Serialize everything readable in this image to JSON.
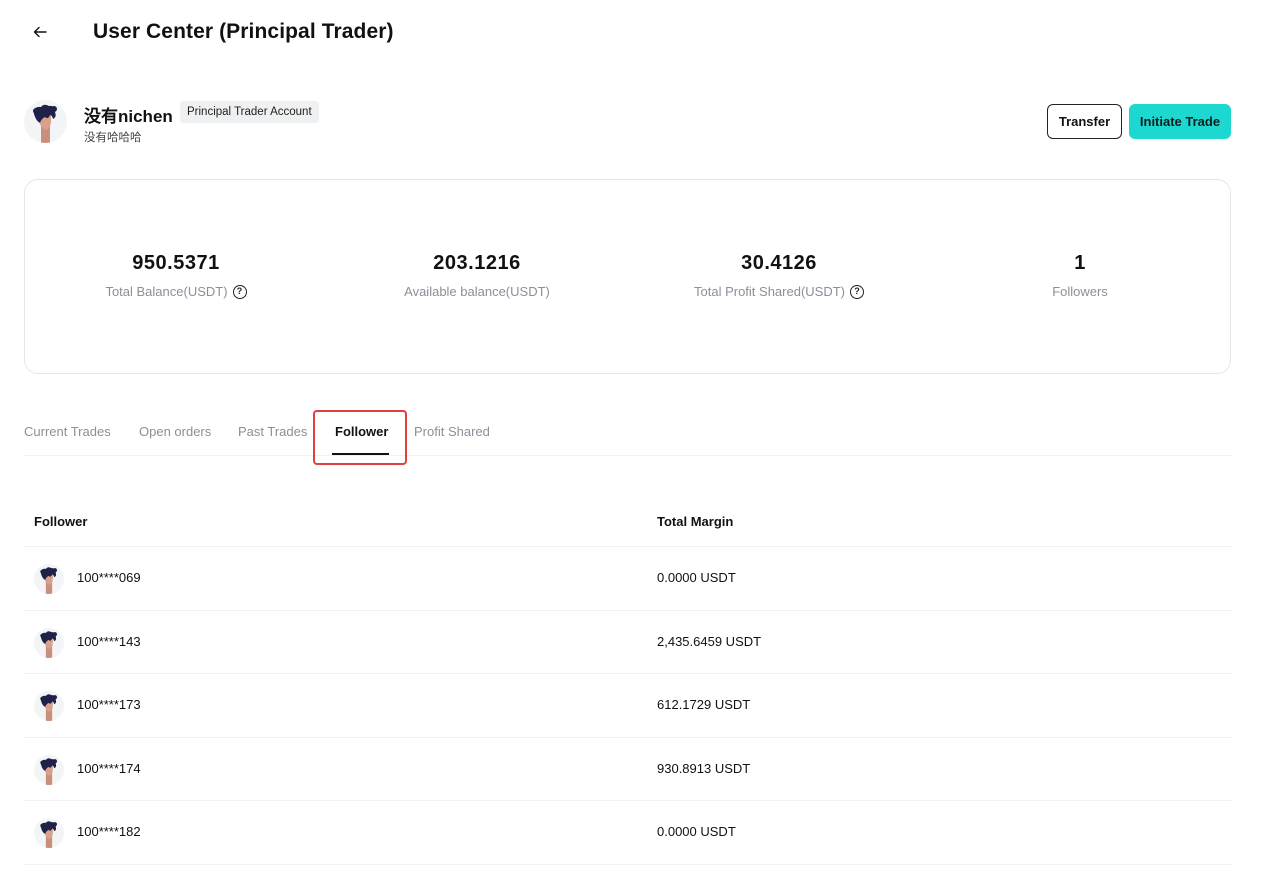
{
  "header": {
    "title": "User Center (Principal Trader)",
    "back_icon": "arrow-left-icon"
  },
  "profile": {
    "username": "没有nichen",
    "account_badge": "Principal Trader Account",
    "subname": "没有哈哈哈"
  },
  "actions": {
    "transfer_label": "Transfer",
    "initiate_label": "Initiate Trade",
    "accent_color": "#1dd8d0"
  },
  "stats": [
    {
      "value": "950.5371",
      "label": "Total Balance(USDT)",
      "help": true
    },
    {
      "value": "203.1216",
      "label": "Available balance(USDT)",
      "help": false
    },
    {
      "value": "30.4126",
      "label": "Total Profit Shared(USDT)",
      "help": true
    },
    {
      "value": "1",
      "label": "Followers",
      "help": false
    }
  ],
  "tabs": [
    {
      "label": "Current Trades",
      "active": false
    },
    {
      "label": "Open orders",
      "active": false
    },
    {
      "label": "Past Trades",
      "active": false
    },
    {
      "label": "Follower",
      "active": true
    },
    {
      "label": "Profit Shared",
      "active": false
    }
  ],
  "table": {
    "columns": [
      "Follower",
      "Total Margin"
    ],
    "rows": [
      {
        "follower": "100****069",
        "margin": "0.0000 USDT"
      },
      {
        "follower": "100****143",
        "margin": "2,435.6459 USDT"
      },
      {
        "follower": "100****173",
        "margin": "612.1729 USDT"
      },
      {
        "follower": "100****174",
        "margin": "930.8913 USDT"
      },
      {
        "follower": "100****182",
        "margin": "0.0000 USDT"
      }
    ]
  },
  "highlight_color": "#e2403e"
}
